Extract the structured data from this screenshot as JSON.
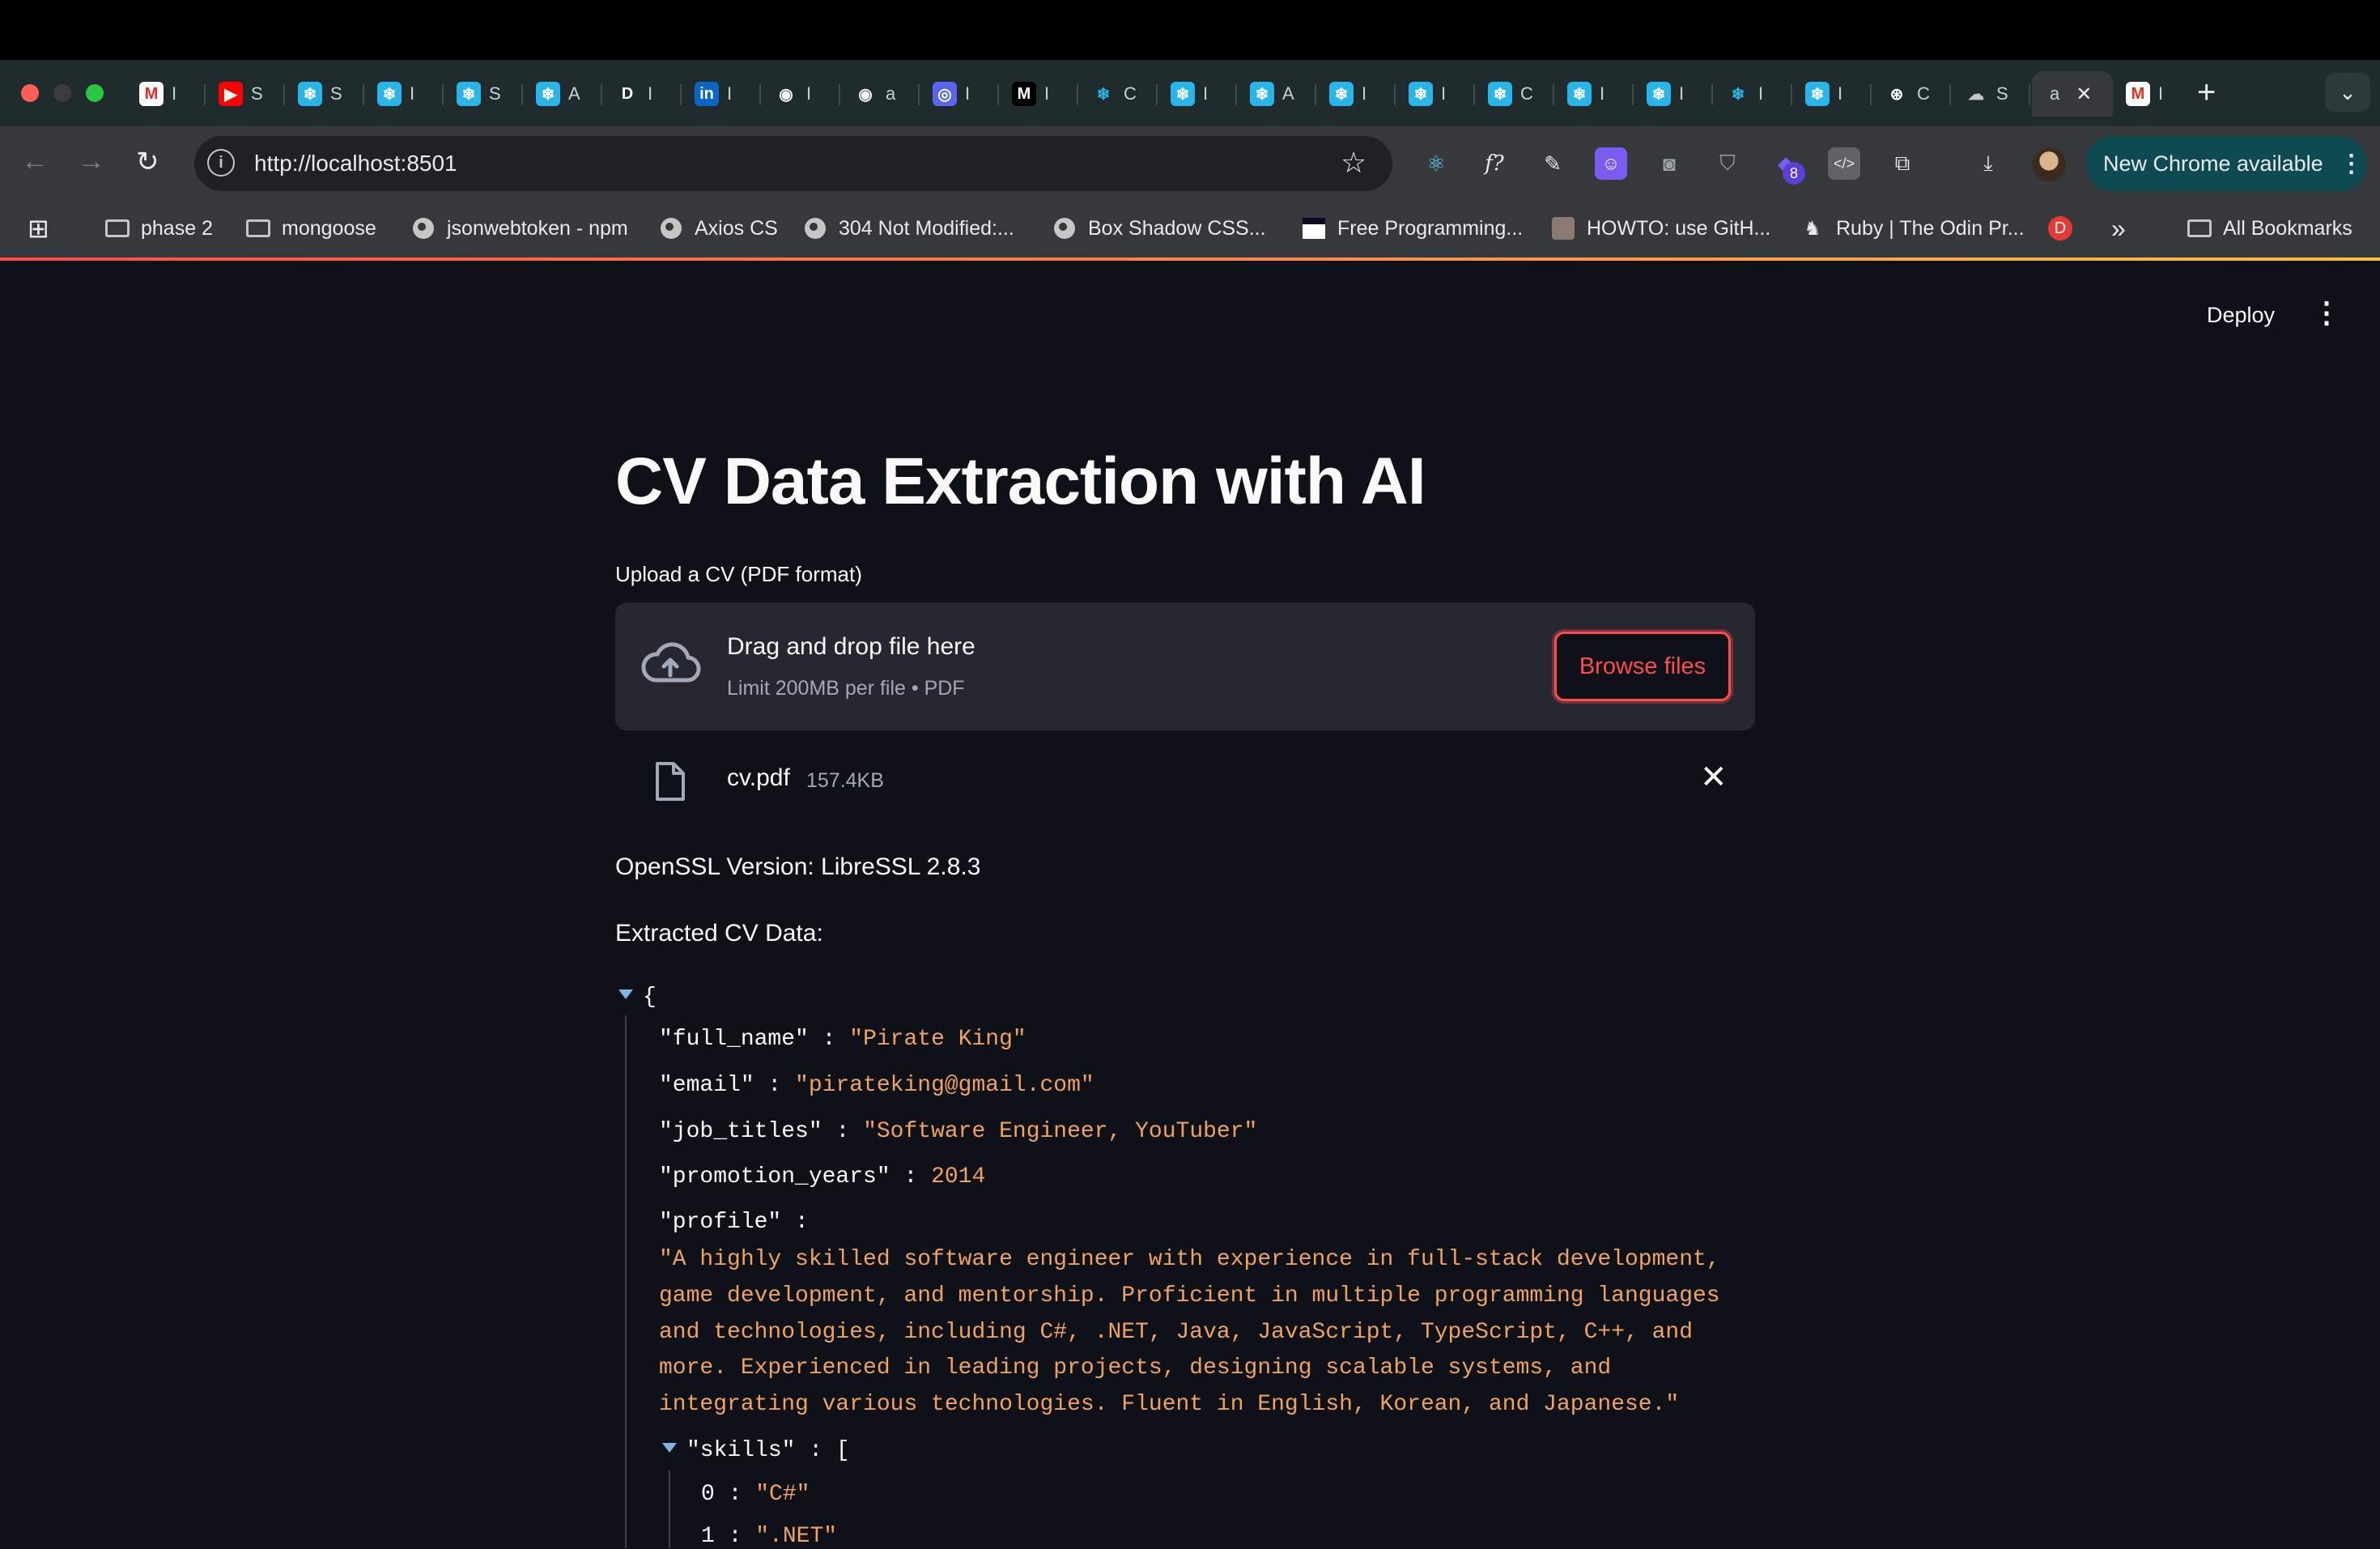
{
  "browser": {
    "tabs": [
      {
        "fav": "M",
        "title": "I",
        "color": "#ffffff",
        "fg": "#d93025"
      },
      {
        "fav": "▶",
        "title": "S",
        "color": "#ff0000",
        "fg": "#ffffff"
      },
      {
        "fav": "❄",
        "title": "S",
        "color": "#29b5e8",
        "fg": "#ffffff"
      },
      {
        "fav": "❄",
        "title": "I",
        "color": "#29b5e8",
        "fg": "#ffffff"
      },
      {
        "fav": "❄",
        "title": "S",
        "color": "#29b5e8",
        "fg": "#ffffff"
      },
      {
        "fav": "❄",
        "title": "A",
        "color": "#29b5e8",
        "fg": "#ffffff"
      },
      {
        "fav": "D",
        "title": "I",
        "color": "#1f2b2d",
        "fg": "#ffffff"
      },
      {
        "fav": "in",
        "title": "I",
        "color": "#0a66c2",
        "fg": "#ffffff"
      },
      {
        "fav": "◉",
        "title": "I",
        "color": "#1f2b2d",
        "fg": "#ffffff"
      },
      {
        "fav": "◉",
        "title": "a",
        "color": "#1f2b2d",
        "fg": "#ffffff"
      },
      {
        "fav": "◎",
        "title": "I",
        "color": "#5865f2",
        "fg": "#ffffff"
      },
      {
        "fav": "M",
        "title": "I",
        "color": "#000000",
        "fg": "#ffffff"
      },
      {
        "fav": "❄",
        "title": "C",
        "color": "#1f2b2d",
        "fg": "#29b5e8"
      },
      {
        "fav": "❄",
        "title": "I",
        "color": "#29b5e8",
        "fg": "#ffffff"
      },
      {
        "fav": "❄",
        "title": "A",
        "color": "#29b5e8",
        "fg": "#ffffff"
      },
      {
        "fav": "❄",
        "title": "I",
        "color": "#29b5e8",
        "fg": "#ffffff"
      },
      {
        "fav": "❄",
        "title": "I",
        "color": "#29b5e8",
        "fg": "#ffffff"
      },
      {
        "fav": "❄",
        "title": "C",
        "color": "#29b5e8",
        "fg": "#ffffff"
      },
      {
        "fav": "❄",
        "title": "I",
        "color": "#29b5e8",
        "fg": "#ffffff"
      },
      {
        "fav": "❄",
        "title": "I",
        "color": "#29b5e8",
        "fg": "#ffffff"
      },
      {
        "fav": "❄",
        "title": "I",
        "color": "#1f2b2d",
        "fg": "#29b5e8"
      },
      {
        "fav": "❄",
        "title": "I",
        "color": "#29b5e8",
        "fg": "#ffffff"
      },
      {
        "fav": "⊛",
        "title": "C",
        "color": "#1f2b2d",
        "fg": "#ffffff"
      },
      {
        "fav": "☁",
        "title": "S",
        "color": "#1f2b2d",
        "fg": "#c4c7c5"
      }
    ],
    "active_tab": {
      "title": "a",
      "close": "✕"
    },
    "after_active_tab": {
      "fav": "M",
      "title": "I"
    },
    "new_tab": "+",
    "tab_search": "⌄",
    "url": "http://localhost:8501",
    "new_chrome_label": "New Chrome available",
    "ext_badge": "8",
    "bookmarks": [
      {
        "icon": "folder",
        "label": "phase 2"
      },
      {
        "icon": "folder",
        "label": "mongoose"
      },
      {
        "icon": "globe",
        "label": "jsonwebtoken - npm"
      },
      {
        "icon": "globe",
        "label": "Axios CS"
      },
      {
        "icon": "globe",
        "label": "304 Not Modified:..."
      },
      {
        "icon": "globe",
        "label": "Box Shadow CSS..."
      },
      {
        "icon": "fcc",
        "label": "Free Programming..."
      },
      {
        "icon": "person",
        "label": "HOWTO: use GitH..."
      },
      {
        "icon": "odin",
        "label": "Ruby | The Odin Pr..."
      }
    ],
    "bookmark_d": "D",
    "bookmark_more": "»",
    "all_bookmarks": "All Bookmarks"
  },
  "app": {
    "deploy": "Deploy",
    "menu": "⋮",
    "title": "CV Data Extraction with AI",
    "upload_label": "Upload a CV (PDF format)",
    "drop_title": "Drag and drop file here",
    "drop_limit": "Limit 200MB per file • PDF",
    "browse": "Browse files",
    "file_name": "cv.pdf",
    "file_size": "157.4KB",
    "file_close": "✕",
    "openssl": "OpenSSL Version: LibreSSL 2.8.3",
    "extracted_label": "Extracted CV Data:"
  },
  "json_view": {
    "open_brace": "{",
    "full_name_key": "\"full_name\"",
    "full_name_val": "\"Pirate King\"",
    "email_key": "\"email\"",
    "email_val": "\"pirateking@gmail.com\"",
    "job_titles_key": "\"job_titles\"",
    "job_titles_val": "\"Software Engineer, YouTuber\"",
    "promotion_years_key": "\"promotion_years\"",
    "promotion_years_val": "2014",
    "profile_key": "\"profile\"",
    "profile_lines": [
      "\"A highly skilled software engineer with experience in full-stack development,",
      "game development, and mentorship. Proficient in multiple programming languages",
      "and technologies, including C#, .NET, Java, JavaScript, TypeScript, C++, and",
      "more. Experienced in leading projects, designing scalable systems, and",
      "integrating various technologies. Fluent in English, Korean, and Japanese.\""
    ],
    "skills_key": "\"skills\"",
    "skills_open": "[",
    "skills": [
      {
        "index": "0",
        "value": "\"C#\""
      },
      {
        "index": "1",
        "value": "\".NET\""
      }
    ],
    "colon": " : "
  }
}
